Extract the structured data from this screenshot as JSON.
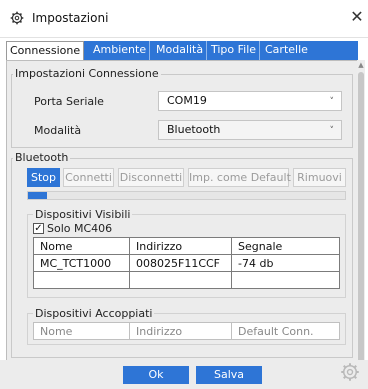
{
  "window": {
    "title": "Impostazioni",
    "icon": "gear-icon",
    "close_label": "✕"
  },
  "tabs": [
    {
      "label": "Connessione",
      "active": true
    },
    {
      "label": "Ambiente"
    },
    {
      "label": "Modalità"
    },
    {
      "label": "Tipo File"
    },
    {
      "label": "Cartelle"
    }
  ],
  "connection": {
    "group_title": "Impostazioni Connessione",
    "port_label": "Porta Seriale",
    "port_value": "COM19",
    "mode_label": "Modalità",
    "mode_value": "Bluetooth"
  },
  "bluetooth": {
    "group_title": "Bluetooth",
    "buttons": {
      "stop": "Stop",
      "connect": "Connetti",
      "disconnect": "Disconnetti",
      "set_default": "Imp. come Default",
      "remove": "Rimuovi"
    },
    "progress_fraction": 0.06,
    "visible": {
      "group_title": "Dispositivi Visibili",
      "filter_label": "Solo MC406",
      "filter_checked": "✓",
      "columns": [
        "Nome",
        "Indirizzo",
        "Segnale"
      ],
      "rows": [
        [
          "MC_TCT1000",
          "008025F11CCF",
          "-74 db"
        ]
      ]
    },
    "paired": {
      "group_title": "Dispositivi Accoppiati",
      "columns": [
        "Nome",
        "Indirizzo",
        "Default Conn."
      ]
    }
  },
  "footer": {
    "ok_label": "Ok",
    "save_label": "Salva",
    "settings_icon": "gear-icon"
  },
  "colors": {
    "accent": "#2e75d6",
    "panel": "#ececec"
  }
}
